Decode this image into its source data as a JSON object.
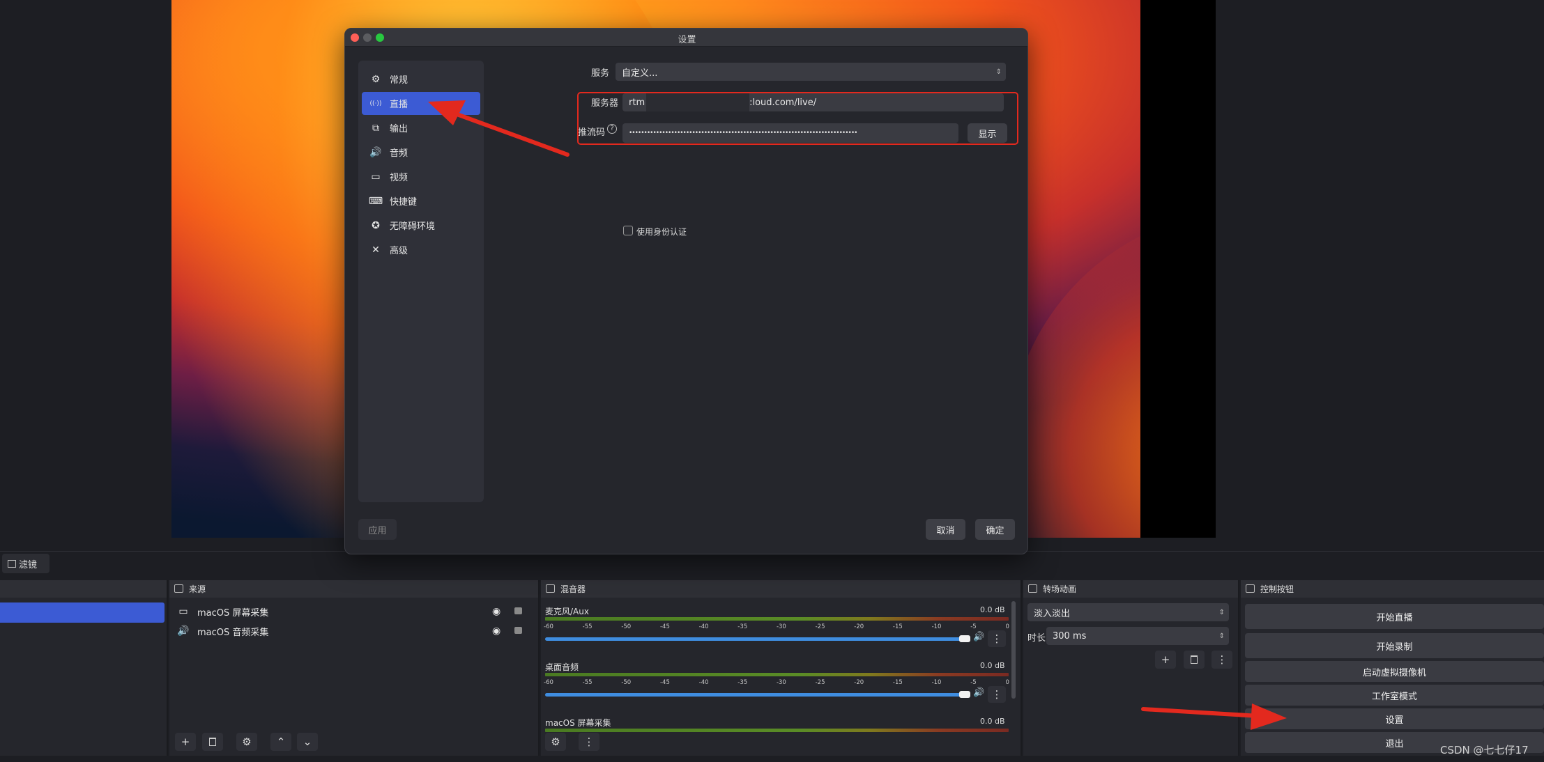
{
  "dialog": {
    "title": "设置",
    "apply_label": "应用",
    "cancel_label": "取消",
    "ok_label": "确定",
    "nav": [
      {
        "label": "常规",
        "icon": "gear-icon",
        "glyph": "⚙"
      },
      {
        "label": "直播",
        "icon": "broadcast-icon",
        "glyph": "((·))",
        "active": true
      },
      {
        "label": "输出",
        "icon": "output-icon",
        "glyph": "⧉"
      },
      {
        "label": "音频",
        "icon": "speaker-icon",
        "glyph": "🔊"
      },
      {
        "label": "视频",
        "icon": "monitor-icon",
        "glyph": "▭"
      },
      {
        "label": "快捷键",
        "icon": "keyboard-icon",
        "glyph": "⌨"
      },
      {
        "label": "无障碍环境",
        "icon": "accessibility-icon",
        "glyph": "✪"
      },
      {
        "label": "高级",
        "icon": "tools-icon",
        "glyph": "✕"
      }
    ],
    "stream": {
      "service_label": "服务",
      "service_value": "自定义...",
      "server_label": "服务器",
      "server_value_prefix": "rtm",
      "server_value_suffix": ":loud.com/live/",
      "key_label": "推流码",
      "key_value": "••••••••••••••••••••••••••••••••••••••••••••••••••••••••••••••••••••••••••••",
      "show_label": "显示",
      "auth_label": "使用身份认证"
    }
  },
  "filters_label": "滤镜",
  "sources": {
    "title": "来源",
    "items": [
      {
        "label": "macOS 屏幕采集",
        "icon": "monitor-icon",
        "glyph": "▭"
      },
      {
        "label": "macOS 音频采集",
        "icon": "speaker-icon",
        "glyph": "🔊"
      }
    ]
  },
  "mixer": {
    "title": "混音器",
    "ticks": [
      "-60",
      "-55",
      "-50",
      "-45",
      "-40",
      "-35",
      "-30",
      "-25",
      "-20",
      "-15",
      "-10",
      "-5",
      "0"
    ],
    "channels": [
      {
        "name": "麦克风/Aux",
        "db": "0.0 dB"
      },
      {
        "name": "桌面音频",
        "db": "0.0 dB"
      },
      {
        "name": "macOS 屏幕采集",
        "db": "0.0 dB"
      }
    ]
  },
  "transitions": {
    "title": "转场动画",
    "type_value": "淡入淡出",
    "duration_label": "时长",
    "duration_value": "300 ms"
  },
  "controls": {
    "title": "控制按钮",
    "buttons": [
      "开始直播",
      "开始录制",
      "启动虚拟摄像机",
      "工作室模式",
      "设置",
      "退出"
    ]
  },
  "watermark": "CSDN @七七仔17",
  "colors": {
    "accent_blue": "#3c5bd4",
    "annotation_red": "#e3291e",
    "slider_blue": "#3f8de0"
  }
}
